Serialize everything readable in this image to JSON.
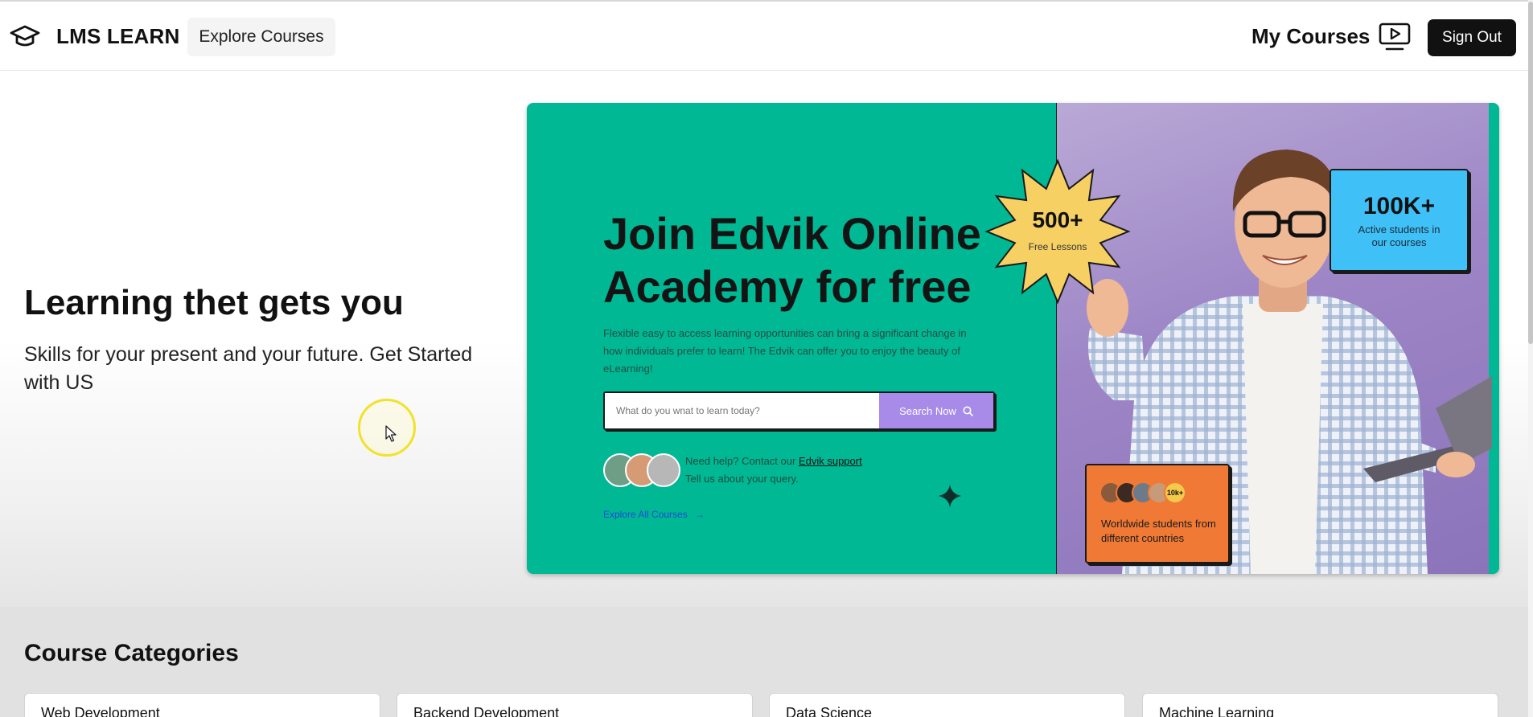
{
  "header": {
    "brand_name": "LMS LEARN",
    "explore_courses_label": "Explore Courses",
    "my_courses_label": "My Courses",
    "sign_out_label": "Sign Out"
  },
  "hero": {
    "title": "Learning thet gets you",
    "subtitle": "Skills for your present and your future. Get Started with US"
  },
  "banner": {
    "heading": "Join Edvik Online Academy for free",
    "description": "Flexible easy to access learning opportunities can bring a significant change in how individuals prefer to learn! The Edvik can offer you to enjoy the beauty of eLearning!",
    "search": {
      "placeholder": "What do you wnat to learn today?",
      "button_label": "Search Now"
    },
    "help_prefix": "Need help? Contact our",
    "help_link": "Edvik support",
    "help_line2": "Tell us about your query.",
    "explore_all_label": "Explore All Courses",
    "explore_all_arrow": "→",
    "lessons_badge": {
      "value": "500+",
      "label": "Free Lessons"
    },
    "students_stat": {
      "value": "100K+",
      "label": "Active students in our courses"
    },
    "worldwide": {
      "count_badge": "10k+",
      "label": "Worldwide students from different countries"
    }
  },
  "colors": {
    "banner_green": "#00b894",
    "banner_purple": "#9d85c6",
    "search_button": "#a88be8",
    "stat_blue": "#3fc0f6",
    "world_orange": "#f07a35",
    "star_yellow": "#f7d064",
    "sign_out_bg": "#111111"
  },
  "icons": [
    "graduation-cap-icon",
    "play-screen-icon",
    "search-icon",
    "arrow-right-icon",
    "sparkle-icon",
    "cursor-arrow-icon"
  ],
  "categories": {
    "title": "Course Categories",
    "items": [
      {
        "label": "Web Development"
      },
      {
        "label": "Backend Development"
      },
      {
        "label": "Data Science"
      },
      {
        "label": "Machine Learning"
      }
    ]
  }
}
